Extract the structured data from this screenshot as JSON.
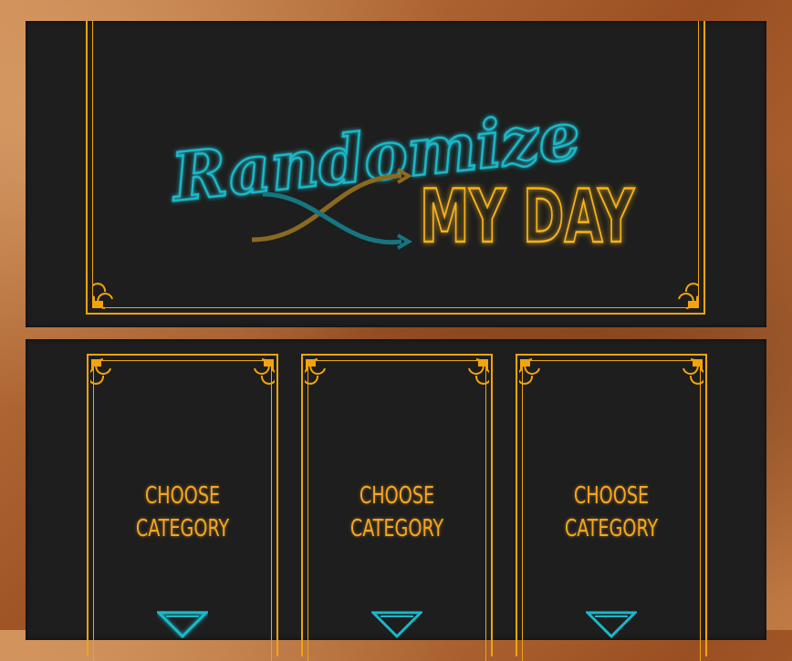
{
  "header": {
    "logo_word_1": "Randomize",
    "logo_word_2": "MY DAY"
  },
  "cards": [
    {
      "line1": "CHOOSE",
      "line2": "CATEGORY"
    },
    {
      "line1": "CHOOSE",
      "line2": "CATEGORY"
    },
    {
      "line1": "CHOOSE",
      "line2": "CATEGORY"
    }
  ],
  "colors": {
    "gold": "#f2a40c",
    "teal": "#1ab8c8",
    "panel": "#1e1e1e",
    "frame_wood": "#b86a35"
  },
  "icons": [
    "shuffle-arrows-icon",
    "chevron-down-icon",
    "ornament-corner-icon"
  ]
}
